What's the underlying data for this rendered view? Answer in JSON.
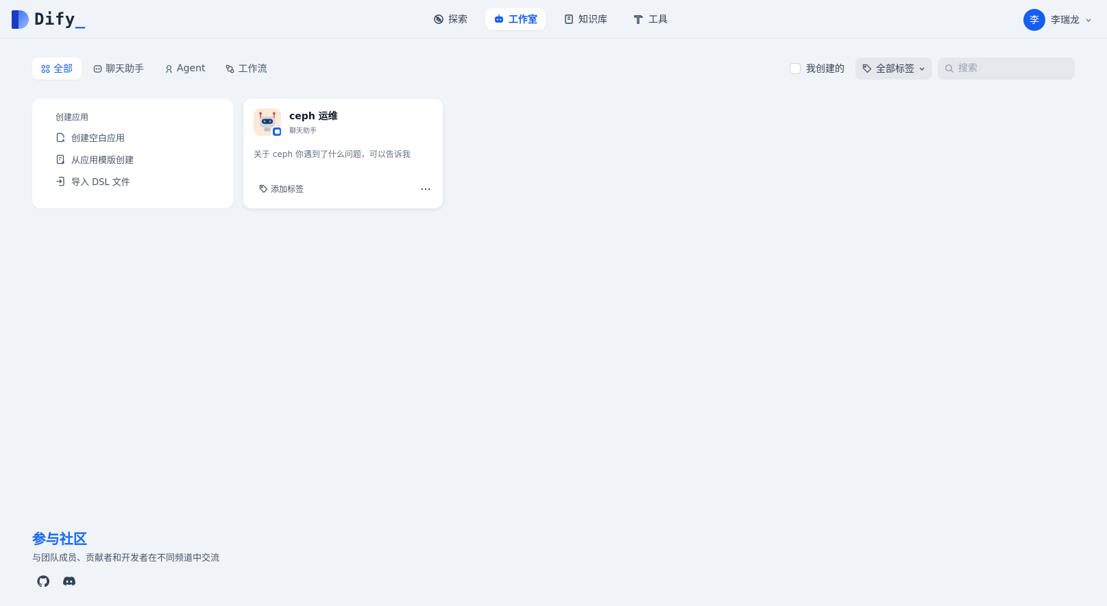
{
  "brand": {
    "name": "Dify",
    "cursor": "_"
  },
  "nav": {
    "items": [
      {
        "label": "探索",
        "icon": "explore-icon"
      },
      {
        "label": "工作室",
        "icon": "robot-icon",
        "active": true
      },
      {
        "label": "知识库",
        "icon": "book-icon"
      },
      {
        "label": "工具",
        "icon": "hammer-icon"
      }
    ]
  },
  "user": {
    "initial": "李",
    "name": "李瑞龙"
  },
  "tabs": [
    {
      "label": "全部",
      "icon": "grid-icon",
      "active": true
    },
    {
      "label": "聊天助手",
      "icon": "chat-icon"
    },
    {
      "label": "Agent",
      "icon": "agent-icon"
    },
    {
      "label": "工作流",
      "icon": "workflow-icon"
    }
  ],
  "filters": {
    "mine_label": "我创建的",
    "mine_checked": false,
    "tag_label": "全部标签",
    "search_placeholder": "搜索"
  },
  "create": {
    "title": "创建应用",
    "items": [
      "创建空白应用",
      "从应用模版创建",
      "导入 DSL 文件"
    ]
  },
  "apps": [
    {
      "name": "ceph 运维",
      "type": "聊天助手",
      "description": "关于 ceph 你遇到了什么问题，可以告诉我",
      "add_tag_label": "添加标签"
    }
  ],
  "footer": {
    "title": "参与社区",
    "subtitle": "与团队成员、贡献者和开发者在不同频道中交流",
    "links": [
      "github-icon",
      "discord-icon"
    ]
  },
  "colors": {
    "accent": "#155eef",
    "background": "#f0f4f8"
  }
}
